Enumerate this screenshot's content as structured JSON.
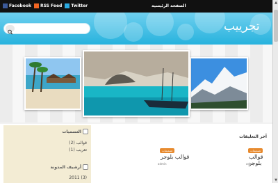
{
  "topbar": {
    "social": [
      {
        "label": "Facebook",
        "icon": "facebook-icon",
        "color": "#3b5998"
      },
      {
        "label": "RSS Feed",
        "icon": "rss-icon",
        "color": "#f26522"
      },
      {
        "label": "Twitter",
        "icon": "twitter-icon",
        "color": "#2aa9e0"
      }
    ],
    "home_label": "الصفحة الرئيسية"
  },
  "header": {
    "site_title": "تجرييب",
    "search_placeholder": ""
  },
  "sidebar": {
    "labels_title": "التسميات",
    "labels": [
      "قوالب (2)",
      "تعريب (1)"
    ],
    "archive_title": "أرشيف المدونة",
    "archive_item": "2011 (3)"
  },
  "main": {
    "recent_title": "آخر التعليقات",
    "posts": [
      {
        "tag": "تصميمات",
        "title": "قوالب بلوجر",
        "meta": "admin"
      },
      {
        "tag": "تصميمات",
        "title": "قوالب بلوجر",
        "meta": "admin"
      }
    ]
  },
  "colors": {
    "header_light": "#6fd0ef",
    "header_dark": "#27b2dd",
    "tag": "#e78a2e",
    "sidebar_bg": "#f3ecd4"
  }
}
